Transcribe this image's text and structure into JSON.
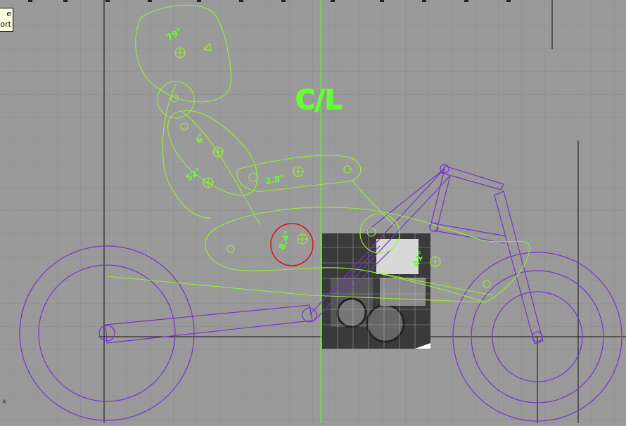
{
  "tooltip": {
    "line1": "e",
    "line2": "ort"
  },
  "centerline_label": "C/L",
  "part_labels": {
    "head": "79°",
    "upper_arm": "6°",
    "forearm": "52°",
    "elbow": "2.8°",
    "hip": "8.4°",
    "knee": "41°"
  },
  "axis_corner_label": "x",
  "colors": {
    "grid_bg": "#9a9a9a",
    "grid_line": "#8a8a8a",
    "rider": "#99ee33",
    "frame": "#7733cc",
    "hip_marker": "#dd1111",
    "centerline": "#66ff33",
    "axis": "#111111"
  }
}
